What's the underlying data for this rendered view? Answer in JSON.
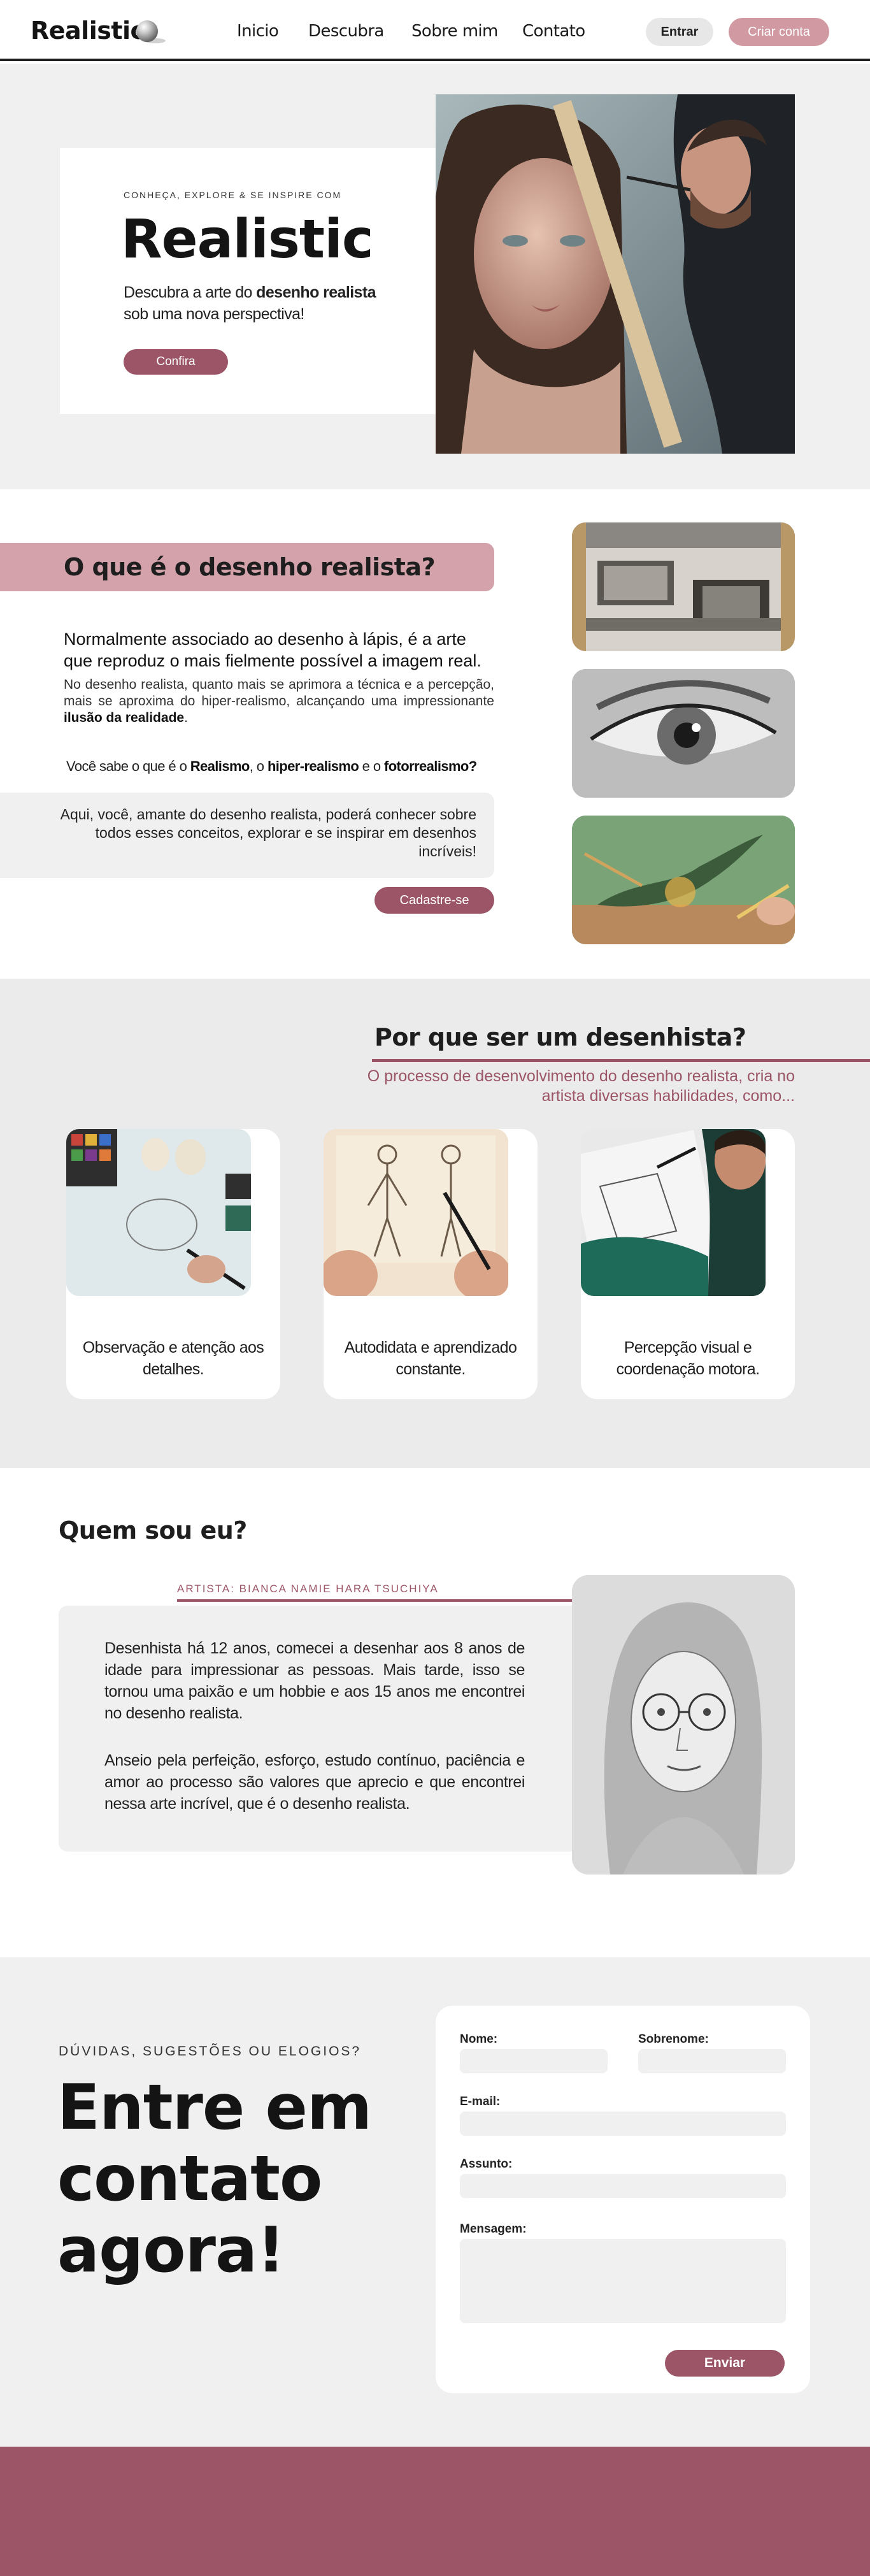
{
  "header": {
    "logo": "Realistic",
    "nav": [
      "Inicio",
      "Descubra",
      "Sobre mim",
      "Contato"
    ],
    "login_label": "Entrar",
    "signup_label": "Criar conta"
  },
  "hero": {
    "kicker": "CONHEÇA, EXPLORE & SE INSPIRE COM",
    "title": "Realistic",
    "text_prefix": "Descubra a arte do ",
    "text_bold": "desenho realista",
    "text_suffix": " sob uma nova perspectiva!",
    "button_label": "Confira"
  },
  "what": {
    "title": "O que é o desenho realista?",
    "lead": "Normalmente associado ao desenho à lápis, é a arte que reproduz o mais fielmente possível a imagem real.",
    "desc_prefix": "No desenho realista, quanto mais se aprimora a técnica e a percepção, mais se aproxima do hiper-realismo, alcançando uma impressionante ",
    "desc_bold": "ilusão da realidade",
    "desc_suffix": ".",
    "question_1": "Você sabe o que é o ",
    "term_1": "Realismo",
    "question_2": ", o ",
    "term_2": "hiper-realismo",
    "question_3": " e o ",
    "term_3": "fotorrealismo?",
    "box_text": "Aqui, você, amante do desenho realista, poderá conhecer sobre todos esses conceitos, explorar e se inspirar em desenhos incríveis!",
    "button_label": "Cadastre-se"
  },
  "why": {
    "title": "Por que ser um desenhista?",
    "subtitle": "O processo de desenvolvimento do desenho realista, cria no artista diversas habilidades, como...",
    "cards": [
      {
        "text": "Observação e atenção aos detalhes."
      },
      {
        "text": "Autodidata e aprendizado constante."
      },
      {
        "text": "Percepção visual e coordenação motora."
      }
    ]
  },
  "about": {
    "title": "Quem sou eu?",
    "artist": "ARTISTA: BIANCA NAMIE HARA TSUCHIYA",
    "p1": "Desenhista há 12 anos, comecei a desenhar aos 8 anos de idade para impressionar as pessoas. Mais tarde, isso se tornou uma paixão e um hobbie e aos 15 anos me encontrei no desenho realista.",
    "p2": "Anseio pela perfeição, esforço, estudo contínuo, paciência e amor ao processo são valores que aprecio e que encontrei nessa arte incrível, que é o desenho realista."
  },
  "contact": {
    "kicker": "DÚVIDAS, SUGESTÕES OU ELOGIOS?",
    "title": "Entre em contato agora!",
    "labels": {
      "first_name": "Nome:",
      "last_name": "Sobrenome:",
      "email": "E-mail:",
      "subject": "Assunto:",
      "message": "Mensagem:"
    },
    "values": {
      "first_name": "",
      "last_name": "",
      "email": "",
      "subject": "",
      "message": ""
    },
    "submit_label": "Enviar"
  },
  "colors": {
    "accent": "#9b5566",
    "accent_light": "#d19aa2",
    "section_gray": "#f0f0f0"
  }
}
